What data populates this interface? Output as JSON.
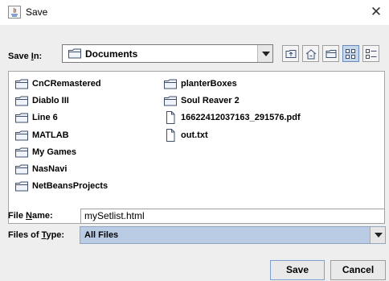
{
  "window": {
    "title": "Save",
    "close_glyph": "✕"
  },
  "save_in": {
    "label_prefix": "Save ",
    "label_mnemonic": "I",
    "label_suffix": "n:",
    "value": "Documents",
    "icon": "folder-icon"
  },
  "toolbar": {
    "buttons": [
      "up-one-level-icon",
      "home-icon",
      "new-folder-icon",
      "list-view-icon",
      "details-view-icon"
    ],
    "selected": "list-view-icon"
  },
  "files": {
    "column1": [
      {
        "name": "CnCRemastered",
        "type": "folder"
      },
      {
        "name": "Diablo III",
        "type": "folder"
      },
      {
        "name": "Line 6",
        "type": "folder"
      },
      {
        "name": "MATLAB",
        "type": "folder"
      },
      {
        "name": "My Games",
        "type": "folder"
      },
      {
        "name": "NasNavi",
        "type": "folder"
      },
      {
        "name": "NetBeansProjects",
        "type": "folder"
      }
    ],
    "column2": [
      {
        "name": "planterBoxes",
        "type": "folder"
      },
      {
        "name": "Soul Reaver 2",
        "type": "folder"
      },
      {
        "name": "16622412037163_291576.pdf",
        "type": "file"
      },
      {
        "name": "out.txt",
        "type": "file"
      }
    ]
  },
  "file_name": {
    "label_prefix": "File ",
    "label_mnemonic": "N",
    "label_suffix": "ame:",
    "value": "mySetlist.html"
  },
  "file_type": {
    "label_prefix": "Files of ",
    "label_mnemonic": "T",
    "label_suffix": "ype:",
    "value": "All Files"
  },
  "buttons": {
    "save": "Save",
    "cancel": "Cancel"
  },
  "colors": {
    "panel": "#eeeeee",
    "selection": "#b9cce4",
    "folder_fill": "#f0f4fa",
    "folder_stroke": "#3d4f6b"
  }
}
